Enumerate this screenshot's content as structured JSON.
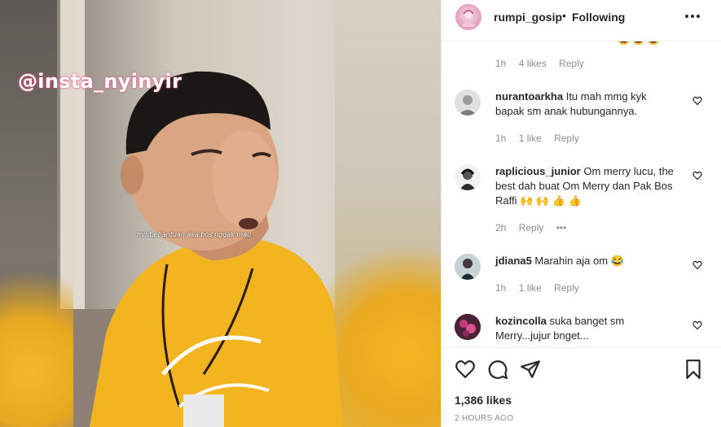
{
  "media": {
    "watermark": "@insta_nyinyir",
    "subtitle": "minta bantuan aka bos nggak mau"
  },
  "header": {
    "username": "rumpi_gosip",
    "separator": "•",
    "follow_status": "Following",
    "more_icon": "more-horizontal-icon"
  },
  "comments": [
    {
      "username": "",
      "text": "",
      "time": "1h",
      "likes": "4 likes",
      "reply": "Reply",
      "partial": true,
      "emojis": "😂 😂 😂"
    },
    {
      "username": "nurantoarkha",
      "text": "Itu mah mmg kyk bapak sm anak hubungannya.",
      "time": "1h",
      "likes": "1 like",
      "reply": "Reply"
    },
    {
      "username": "raplicious_junior",
      "text": "Om merry lucu, the best dah buat Om Merry dan Pak Bos Raffi 🙌 🙌 👍 👍",
      "time": "2h",
      "likes": "",
      "reply": "Reply",
      "more": "•••"
    },
    {
      "username": "jdiana5",
      "text": "Marahin aja om 😂",
      "time": "1h",
      "likes": "1 like",
      "reply": "Reply"
    },
    {
      "username": "kozincolla",
      "text": "suka banget sm Merry...jujur bnget...",
      "time": "",
      "likes": "",
      "reply": ""
    }
  ],
  "actions": {
    "like_icon": "heart-icon",
    "comment_icon": "comment-icon",
    "share_icon": "send-icon",
    "save_icon": "bookmark-icon"
  },
  "likes_count": "1,386 likes",
  "posted_time": "2 HOURS AGO"
}
